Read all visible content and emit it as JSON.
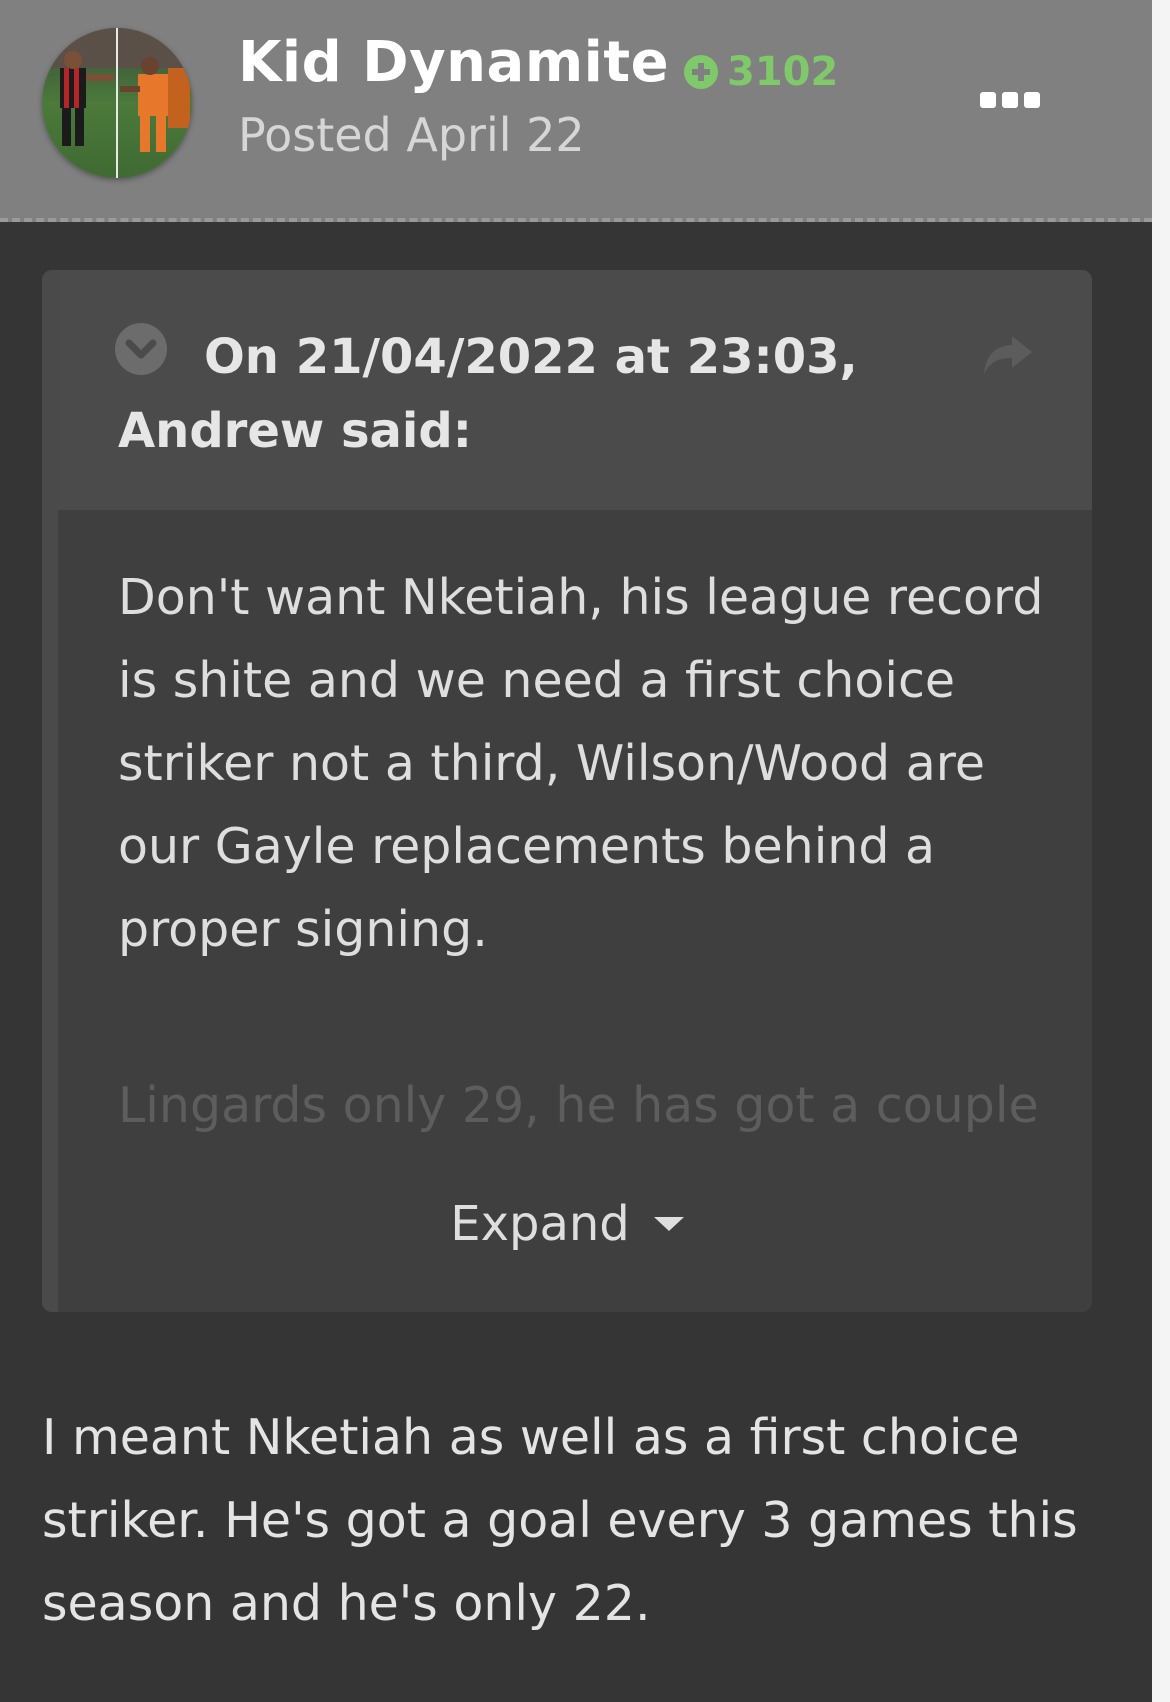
{
  "post": {
    "author": "Kid Dynamite",
    "reputation": "3102",
    "date": "Posted April 22"
  },
  "quote": {
    "citation": "On 21/04/2022 at 23:03, Andrew said:",
    "body": "Don't want Nketiah, his league record is shite and we need a first choice striker not a third, Wilson/Wood are our Gayle replacements behind a proper signing.",
    "faded_line": "Lingards only 29, he has got a couple",
    "expand_label": "Expand"
  },
  "reply": {
    "body": "I meant Nketiah as well as a first choice striker. He's got a goal every 3 games this season and he's only 22."
  },
  "colors": {
    "header_bg": "#808080",
    "page_bg": "#353535",
    "quote_bg": "#3f3f3f",
    "reputation_green": "#7fc96b"
  },
  "icons": {
    "reputation": "plus-circle-icon",
    "menu": "ellipsis-icon",
    "toggle": "chevron-down-circle-icon",
    "share": "share-arrow-icon",
    "expand": "caret-down-icon"
  }
}
